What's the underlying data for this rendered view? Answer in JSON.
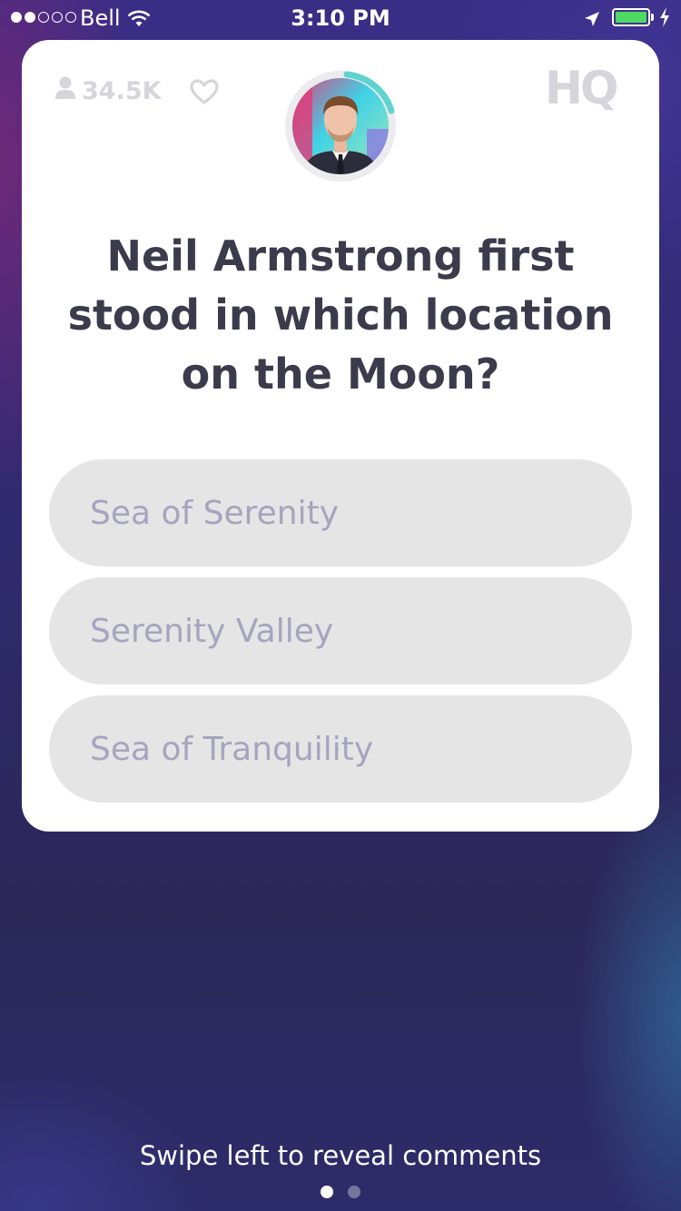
{
  "status_bar": {
    "carrier": "Bell",
    "time": "3:10 PM",
    "signal_strength": 2,
    "battery_level": 1.0,
    "battery_color": "#4cd964"
  },
  "card": {
    "viewer_count": "34.5K",
    "logo": "HQ",
    "host_avatar": "host-photo",
    "timer_color": "#5ed3cf",
    "question": "Neil Armstrong first stood in which location on the Moon?",
    "answers": [
      {
        "label": "Sea of Serenity"
      },
      {
        "label": "Serenity Valley"
      },
      {
        "label": "Sea of Tranquility"
      }
    ]
  },
  "footer": {
    "hint": "Swipe left to reveal comments",
    "page_count": 2,
    "active_page": 1
  },
  "icons": {
    "viewer": "person-icon",
    "like": "heart-icon",
    "wifi": "wifi-icon",
    "location": "location-arrow-icon",
    "charging": "bolt-icon"
  }
}
